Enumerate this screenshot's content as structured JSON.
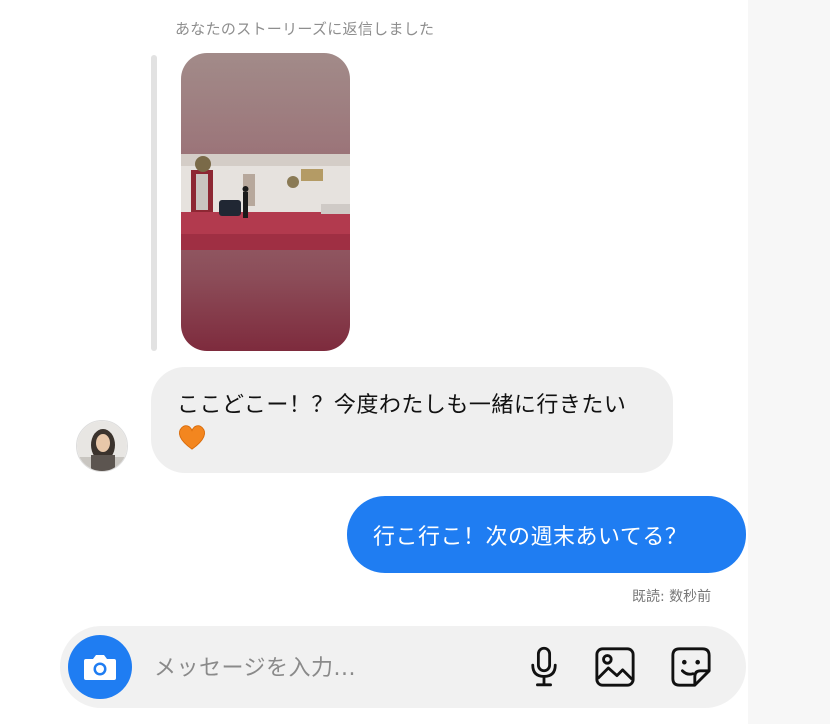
{
  "thread": {
    "reply_note": "あなたのストーリーズに返信しました",
    "story": {
      "icon": "story-photo"
    },
    "incoming": {
      "text": "ここどこー！？今度わたしも一緒に行きたい",
      "emoji_icon": "orange-heart-icon"
    },
    "outgoing": {
      "text": "行こ行こ！次の週末あいてる？"
    },
    "read_receipt": "既読: 数秒前"
  },
  "composer": {
    "placeholder": "メッセージを入力...",
    "icons": [
      "camera-icon",
      "microphone-icon",
      "gallery-icon",
      "sticker-icon"
    ]
  },
  "colors": {
    "accent": "#1f7df2",
    "incoming_bubble": "#efefef",
    "composer_bg": "#f1f1f1",
    "meta_text": "#8e8e8e"
  }
}
